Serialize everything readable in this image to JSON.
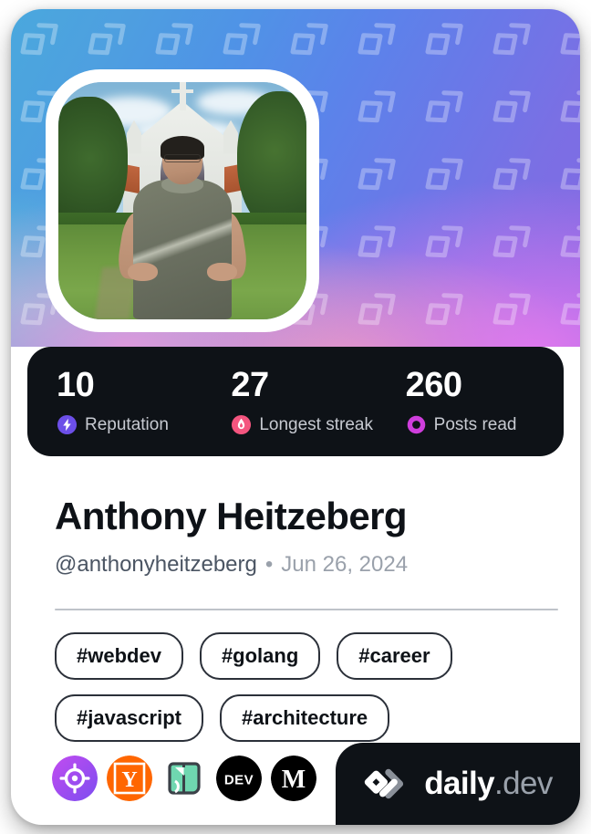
{
  "card": {
    "banner": {
      "watermark_icon": "daily-dev-chevron-pattern",
      "gradient_from": "#4aa8dd",
      "gradient_to": "#8168e2"
    },
    "avatar": {
      "alt": "Profile photo",
      "border_color": "#ffffff"
    }
  },
  "stats": [
    {
      "value": "10",
      "label": "Reputation",
      "icon": "reputation-bolt-icon",
      "color": "#6c4fe8"
    },
    {
      "value": "27",
      "label": "Longest streak",
      "icon": "streak-flame-icon",
      "color": "#f4557f"
    },
    {
      "value": "260",
      "label": "Posts read",
      "icon": "posts-read-ring-icon",
      "color": "#cf3edc"
    }
  ],
  "profile": {
    "name": "Anthony Heitzeberg",
    "handle": "@anthonyheitzeberg",
    "separator": "•",
    "date": "Jun 26, 2024"
  },
  "tags": [
    "#webdev",
    "#golang",
    "#career",
    "#javascript",
    "#architecture"
  ],
  "sources": [
    {
      "name": "crosshair-target-icon",
      "title": "Target",
      "color": "#a855f7"
    },
    {
      "name": "hacker-news-icon",
      "title": "Hacker News",
      "color": "#ff6600"
    },
    {
      "name": "dzone-icon",
      "title": "DZone",
      "color": "#6fd7b0"
    },
    {
      "name": "devto-icon",
      "title": "DEV",
      "color": "#000000"
    },
    {
      "name": "medium-icon",
      "title": "Medium",
      "color": "#000000"
    }
  ],
  "brand": {
    "logo_icon": "daily-dev-logo-icon",
    "name": "daily",
    "suffix": ".dev"
  }
}
